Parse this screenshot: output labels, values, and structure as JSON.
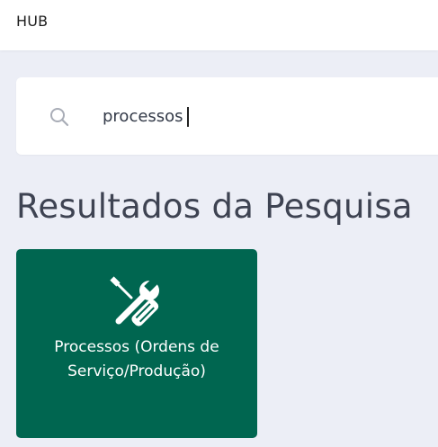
{
  "header": {
    "brand": "HUB"
  },
  "search": {
    "value": "processos",
    "icon": "search-icon"
  },
  "results": {
    "title": "Resultados da Pesquisa",
    "items": [
      {
        "label": "Processos (Ordens de Serviço/Produção)",
        "icon": "tools-icon",
        "color": "#006650"
      }
    ]
  },
  "colors": {
    "accent": "#006650",
    "background": "#eceef6"
  }
}
